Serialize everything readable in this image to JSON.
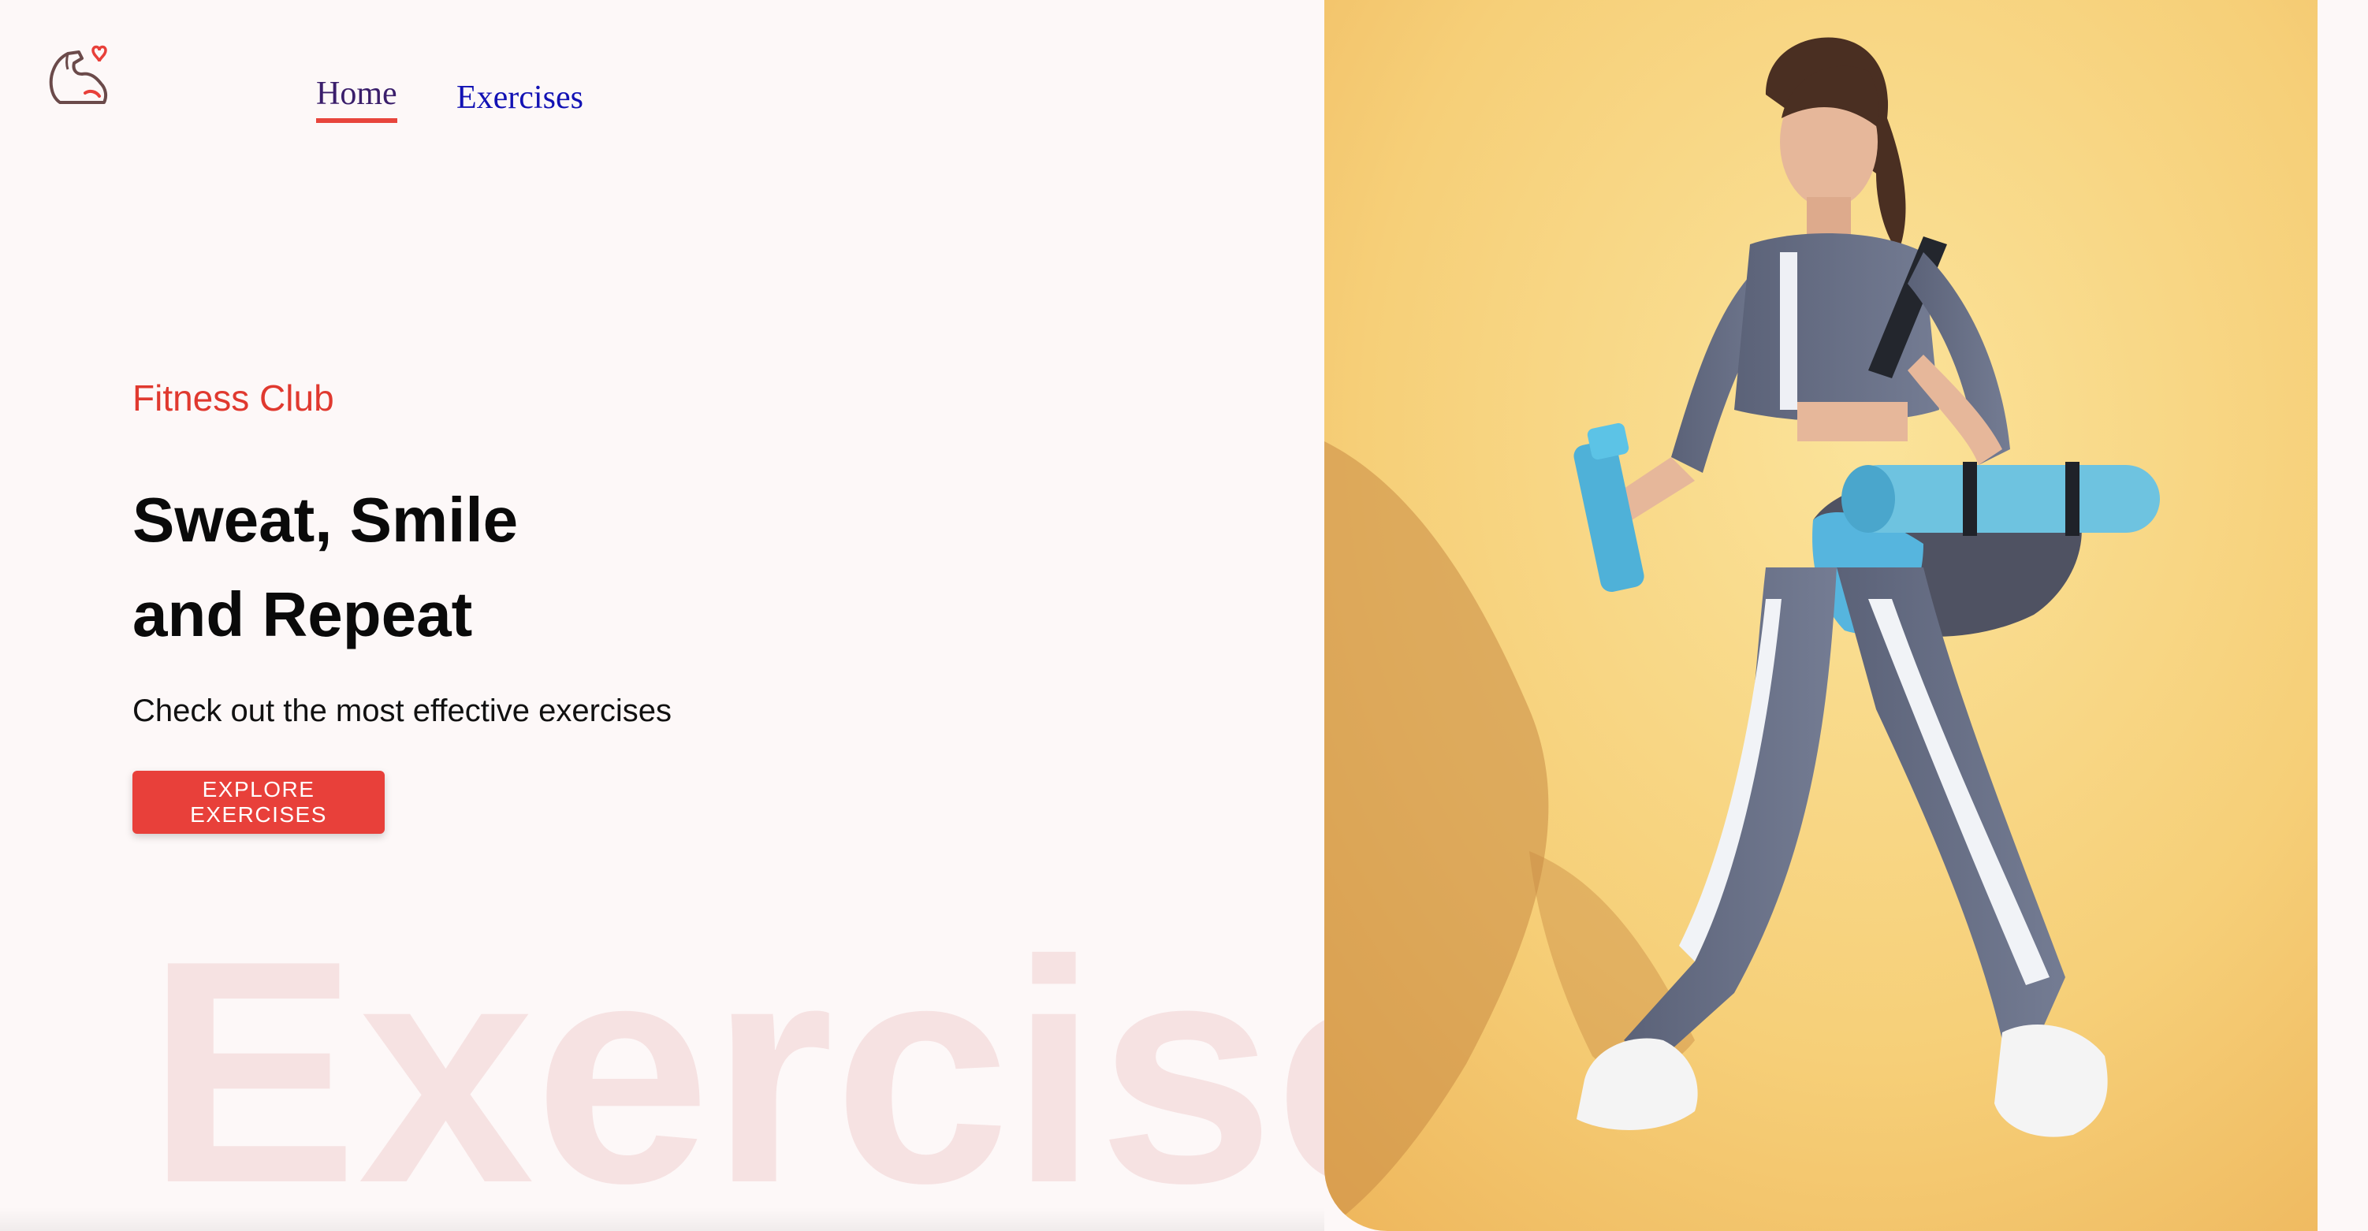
{
  "nav": {
    "logo_icon": "flexed-arm-heart-icon",
    "links": [
      {
        "label": "Home",
        "active": true
      },
      {
        "label": "Exercises",
        "active": false
      }
    ]
  },
  "hero": {
    "eyebrow": "Fitness Club",
    "headline_line1": "Sweat, Smile",
    "headline_line2": "and Repeat",
    "subtext": "Check out the most effective exercises",
    "cta_label": "EXPLORE EXERCISES",
    "watermark": "Exercise",
    "image_icon": "woman-walking-with-gym-bag-photo"
  },
  "colors": {
    "accent": "#e8403a",
    "background": "#fdf8f8",
    "nav_active": "#3a1e6b",
    "nav_link": "#1212b4",
    "watermark": "#f6e2e2",
    "photo_background": "#f8d27a"
  }
}
